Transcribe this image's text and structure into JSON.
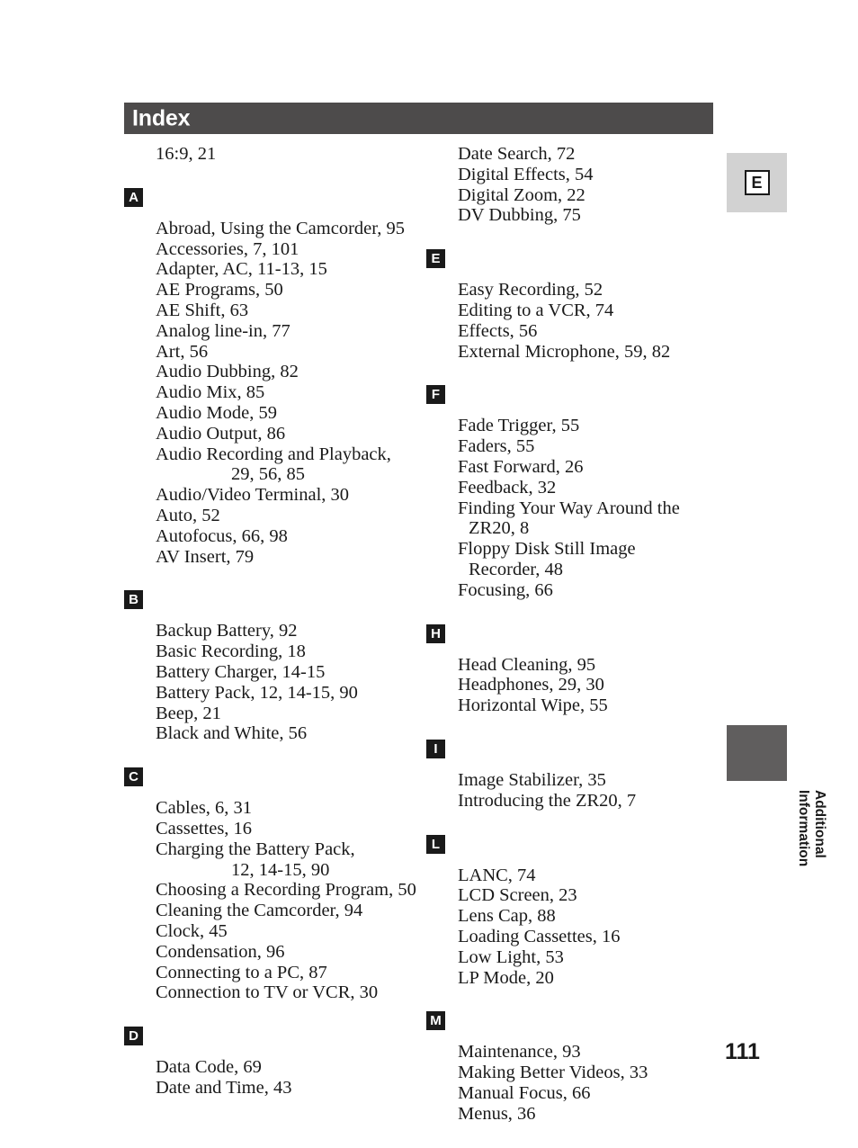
{
  "header": {
    "title": "Index"
  },
  "intro_entry": "16:9, 21",
  "left_column": [
    {
      "letter": "A",
      "entries": [
        {
          "text": "Abroad, Using the Camcorder, 95",
          "indent": "none"
        },
        {
          "text": "Accessories, 7, 101",
          "indent": "none"
        },
        {
          "text": "Adapter, AC, 11-13, 15",
          "indent": "none"
        },
        {
          "text": "AE Programs, 50",
          "indent": "none"
        },
        {
          "text": "AE Shift, 63",
          "indent": "none"
        },
        {
          "text": "Analog line-in, 77",
          "indent": "none"
        },
        {
          "text": "Art, 56",
          "indent": "none"
        },
        {
          "text": "Audio Dubbing, 82",
          "indent": "none"
        },
        {
          "text": "Audio Mix, 85",
          "indent": "none"
        },
        {
          "text": "Audio Mode, 59",
          "indent": "none"
        },
        {
          "text": "Audio Output, 86",
          "indent": "none"
        },
        {
          "text": "Audio Recording and Playback,",
          "indent": "none"
        },
        {
          "text": "29, 56, 85",
          "indent": "big"
        },
        {
          "text": "Audio/Video Terminal, 30",
          "indent": "none"
        },
        {
          "text": "Auto, 52",
          "indent": "none"
        },
        {
          "text": "Autofocus, 66, 98",
          "indent": "none"
        },
        {
          "text": "AV Insert, 79",
          "indent": "none"
        }
      ]
    },
    {
      "letter": "B",
      "entries": [
        {
          "text": "Backup Battery, 92",
          "indent": "none"
        },
        {
          "text": "Basic Recording, 18",
          "indent": "none"
        },
        {
          "text": "Battery Charger, 14-15",
          "indent": "none"
        },
        {
          "text": "Battery Pack, 12, 14-15, 90",
          "indent": "none"
        },
        {
          "text": "Beep, 21",
          "indent": "none"
        },
        {
          "text": "Black and White, 56",
          "indent": "none"
        }
      ]
    },
    {
      "letter": "C",
      "entries": [
        {
          "text": "Cables, 6, 31",
          "indent": "none"
        },
        {
          "text": "Cassettes, 16",
          "indent": "none"
        },
        {
          "text": "Charging the Battery Pack,",
          "indent": "none"
        },
        {
          "text": "12, 14-15, 90",
          "indent": "big"
        },
        {
          "text": "Choosing a Recording Program, 50",
          "indent": "none"
        },
        {
          "text": "Cleaning the Camcorder, 94",
          "indent": "none"
        },
        {
          "text": "Clock, 45",
          "indent": "none"
        },
        {
          "text": "Condensation, 96",
          "indent": "none"
        },
        {
          "text": "Connecting to a PC, 87",
          "indent": "none"
        },
        {
          "text": "Connection to TV or VCR, 30",
          "indent": "none"
        }
      ]
    },
    {
      "letter": "D",
      "entries": [
        {
          "text": "Data Code, 69",
          "indent": "none"
        },
        {
          "text": "Date and Time, 43",
          "indent": "none"
        }
      ]
    }
  ],
  "right_column": [
    {
      "letter": "",
      "entries": [
        {
          "text": "Date Search, 72",
          "indent": "none"
        },
        {
          "text": "Digital Effects, 54",
          "indent": "none"
        },
        {
          "text": "Digital Zoom, 22",
          "indent": "none"
        },
        {
          "text": "DV Dubbing, 75",
          "indent": "none"
        }
      ]
    },
    {
      "letter": "E",
      "entries": [
        {
          "text": "Easy Recording, 52",
          "indent": "none"
        },
        {
          "text": "Editing to a VCR, 74",
          "indent": "none"
        },
        {
          "text": "Effects, 56",
          "indent": "none"
        },
        {
          "text": "External Microphone, 59, 82",
          "indent": "none"
        }
      ]
    },
    {
      "letter": "F",
      "entries": [
        {
          "text": "Fade Trigger, 55",
          "indent": "none"
        },
        {
          "text": "Faders, 55",
          "indent": "none"
        },
        {
          "text": "Fast Forward, 26",
          "indent": "none"
        },
        {
          "text": "Feedback, 32",
          "indent": "none"
        },
        {
          "text": "Finding Your Way Around the",
          "indent": "none"
        },
        {
          "text": "ZR20, 8",
          "indent": "small"
        },
        {
          "text": "Floppy Disk Still Image",
          "indent": "none"
        },
        {
          "text": "Recorder, 48",
          "indent": "small"
        },
        {
          "text": "Focusing, 66",
          "indent": "none"
        }
      ]
    },
    {
      "letter": "H",
      "entries": [
        {
          "text": "Head Cleaning, 95",
          "indent": "none"
        },
        {
          "text": "Headphones, 29, 30",
          "indent": "none"
        },
        {
          "text": "Horizontal Wipe, 55",
          "indent": "none"
        }
      ]
    },
    {
      "letter": "I",
      "entries": [
        {
          "text": "Image Stabilizer, 35",
          "indent": "none"
        },
        {
          "text": "Introducing the ZR20, 7",
          "indent": "none"
        }
      ]
    },
    {
      "letter": "L",
      "entries": [
        {
          "text": "LANC, 74",
          "indent": "none"
        },
        {
          "text": "LCD Screen, 23",
          "indent": "none"
        },
        {
          "text": "Lens Cap, 88",
          "indent": "none"
        },
        {
          "text": "Loading Cassettes, 16",
          "indent": "none"
        },
        {
          "text": "Low Light, 53",
          "indent": "none"
        },
        {
          "text": "LP Mode, 20",
          "indent": "none"
        }
      ]
    },
    {
      "letter": "M",
      "entries": [
        {
          "text": "Maintenance, 93",
          "indent": "none"
        },
        {
          "text": "Making Better Videos, 33",
          "indent": "none"
        },
        {
          "text": "Manual Focus, 66",
          "indent": "none"
        },
        {
          "text": "Menus, 36",
          "indent": "none"
        }
      ]
    }
  ],
  "side_tab": {
    "letter": "E",
    "chapter_label": "Additional\nInformation"
  },
  "page_number": "111",
  "colors": {
    "header_bar": "#4d4b4b",
    "letter_badge": "#1a1a1a",
    "side_tab_light": "#d2d2d2",
    "side_tab_dark": "#605e5e",
    "text": "#1a1a1a"
  }
}
